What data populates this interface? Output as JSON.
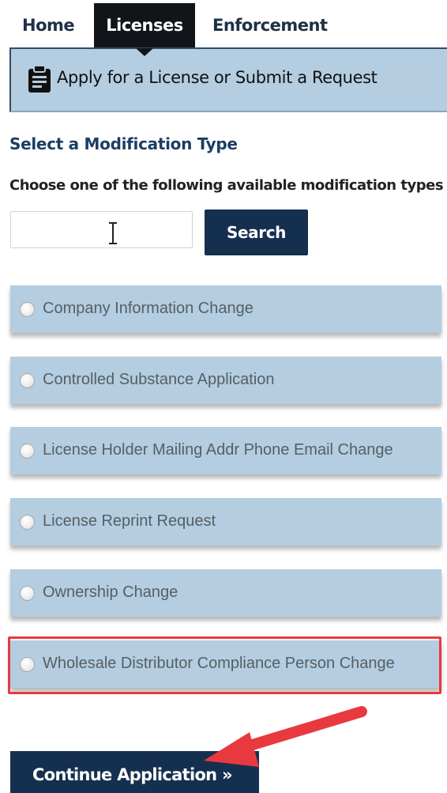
{
  "nav": {
    "tabs": [
      {
        "label": "Home",
        "active": false
      },
      {
        "label": "Licenses",
        "active": true
      },
      {
        "label": "Enforcement",
        "active": false
      }
    ]
  },
  "banner": {
    "icon": "clipboard-icon",
    "text": "Apply for a License or Submit a Request"
  },
  "section": {
    "title": "Select a Modification Type",
    "instructions": "Choose one of the following available modification types"
  },
  "search": {
    "value": "",
    "placeholder": "",
    "button_label": "Search"
  },
  "options": [
    {
      "label": "Company Information Change",
      "selected": false
    },
    {
      "label": "Controlled Substance Application",
      "selected": false
    },
    {
      "label": "License Holder Mailing Addr Phone Email Change",
      "selected": false
    },
    {
      "label": "License Reprint Request",
      "selected": false
    },
    {
      "label": "Ownership Change",
      "selected": false
    },
    {
      "label": "Wholesale Distributor Compliance Person Change",
      "selected": false
    }
  ],
  "continue": {
    "label": "Continue Application »"
  },
  "colors": {
    "nav_active_bg": "#111418",
    "banner_bg": "#b4cde0",
    "primary_button": "#15304f",
    "heading": "#1c3e63",
    "annotation": "#e8393f"
  }
}
